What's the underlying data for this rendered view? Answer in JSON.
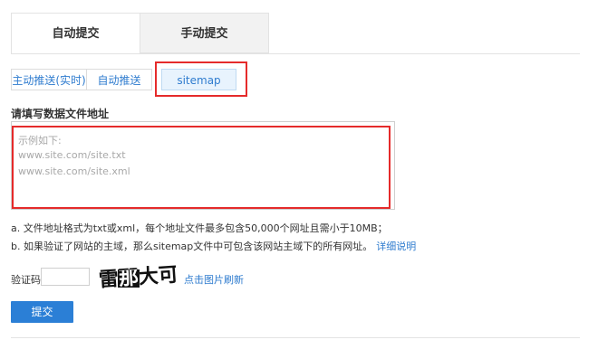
{
  "main_tabs": [
    {
      "label": "自动提交"
    },
    {
      "label": "手动提交"
    }
  ],
  "sub_tabs": [
    {
      "label": "主动推送(实时)"
    },
    {
      "label": "自动推送"
    },
    {
      "label": "sitemap"
    }
  ],
  "form": {
    "section_label": "请填写数据文件地址",
    "placeholder_lines": [
      "示例如下:",
      "www.site.com/site.txt",
      "www.site.com/site.xml"
    ],
    "note_a": "a. 文件地址格式为txt或xml，每个地址文件最多包含50,000个网址且需小于10MB；",
    "note_b": "b. 如果验证了网站的主域，那么sitemap文件中可包含该网站主域下的所有网址。",
    "note_b_link": "详细说明",
    "captcha_label": "验证码",
    "captcha_text": "雷那大可",
    "captcha_refresh": "点击图片刷新",
    "submit_label": "提交"
  },
  "colors": {
    "accent": "#2b7fd6",
    "link": "#2f7ccf",
    "highlight_box": "#e52b2b"
  }
}
